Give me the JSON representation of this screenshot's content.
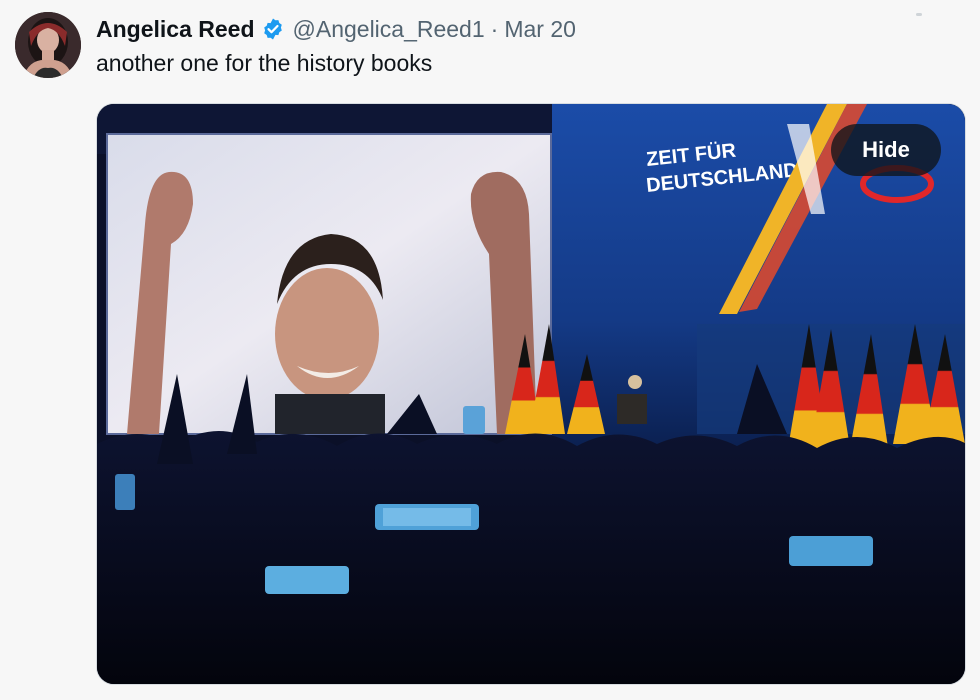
{
  "tweet": {
    "author_name": "Angelica Reed",
    "handle": "@Angelica_Reed1",
    "separator": "·",
    "date": "Mar 20",
    "text": "another one for the history books",
    "verified": true
  },
  "media": {
    "hide_label": "Hide",
    "stage_banner_line1": "ZEIT FÜR",
    "stage_banner_line2": "DEUTSCHLAND."
  },
  "colors": {
    "verified_badge": "#1d9bf0",
    "name_text": "#0f1419",
    "secondary_text": "#536471",
    "hide_button_bg": "#0f1419"
  },
  "icons": {
    "verified": "verified-badge-icon",
    "more": "more-icon"
  }
}
